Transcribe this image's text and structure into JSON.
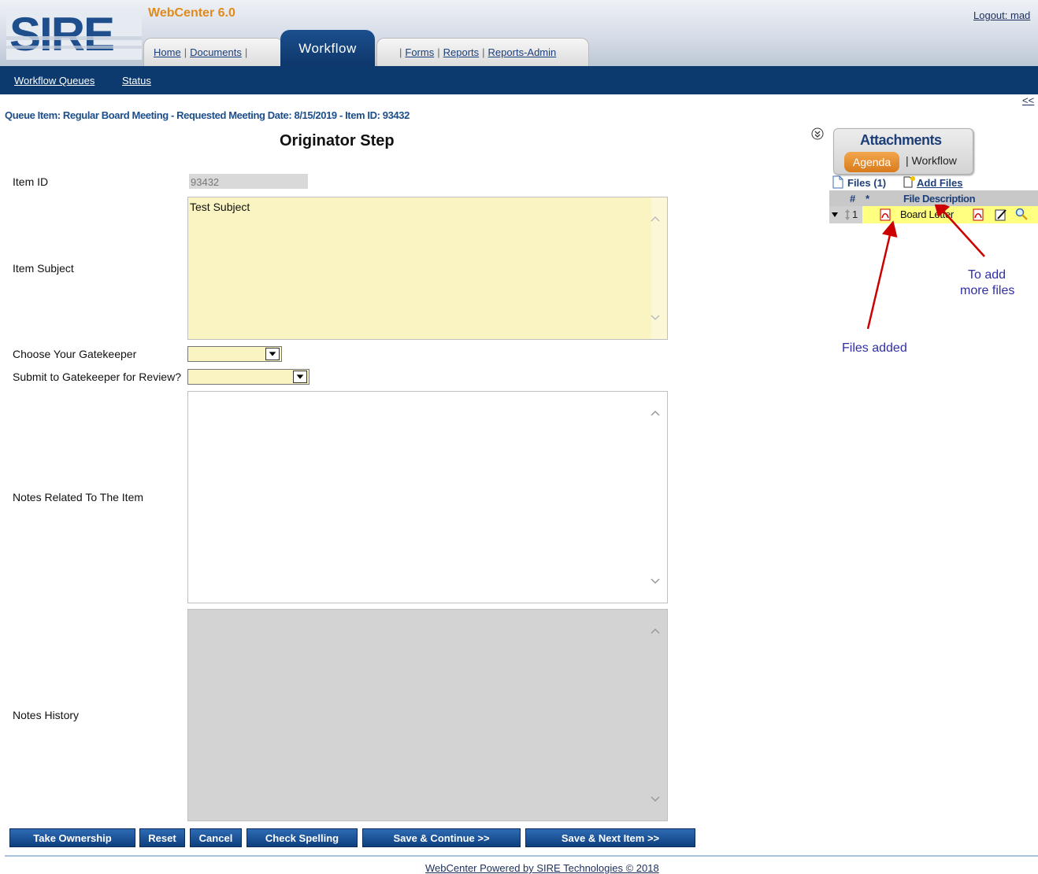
{
  "header": {
    "logo_text": "SIRE",
    "app_title": "WebCenter 6.0",
    "logout": "Logout: mad",
    "tabs_left": [
      "Home",
      "Documents"
    ],
    "active_tab": "Workflow",
    "tabs_right": [
      "Forms",
      "Reports",
      "Reports-Admin"
    ]
  },
  "navbar": {
    "items": [
      "Workflow Queues",
      "Status"
    ]
  },
  "collapse_link": "<<",
  "queue_title": "Queue Item: Regular Board Meeting - Requested Meeting Date: 8/15/2019 - Item ID: 93432",
  "step_title": "Originator Step",
  "form": {
    "item_id_label": "Item ID",
    "item_id_value": "93432",
    "subject_label": "Item Subject",
    "subject_value": "Test Subject",
    "gatekeeper_label": "Choose Your Gatekeeper",
    "gatekeeper_value": "",
    "submit_label": "Submit to Gatekeeper for Review?",
    "submit_value": "",
    "notes_label": "Notes Related To The Item",
    "notes_value": "",
    "history_label": "Notes History",
    "history_value": ""
  },
  "attachments": {
    "title": "Attachments",
    "tabs": [
      "Agenda",
      "Workflow"
    ],
    "active_tab": "Agenda",
    "files_link": "Files (1)",
    "add_files_link": "Add Files",
    "columns": [
      "#",
      "*",
      "File Description"
    ],
    "files": [
      {
        "number": "1",
        "description": "Board Letter"
      }
    ]
  },
  "annotations": {
    "add_files_note_line1": "To add",
    "add_files_note_line2": "more files",
    "files_added_note": "Files added",
    "arrow_color": "#cc0000"
  },
  "buttons": [
    "Take Ownership",
    "Reset",
    "Cancel",
    "Check Spelling",
    "Save & Continue >>",
    "Save & Next Item >>"
  ],
  "footer": "WebCenter Powered by SIRE Technologies © 2018",
  "colors": {
    "brand_blue": "#0d3a6e",
    "accent_orange": "#e08a1e",
    "input_yellow": "#faf4c2",
    "readonly_gray": "#d9d9d9"
  }
}
